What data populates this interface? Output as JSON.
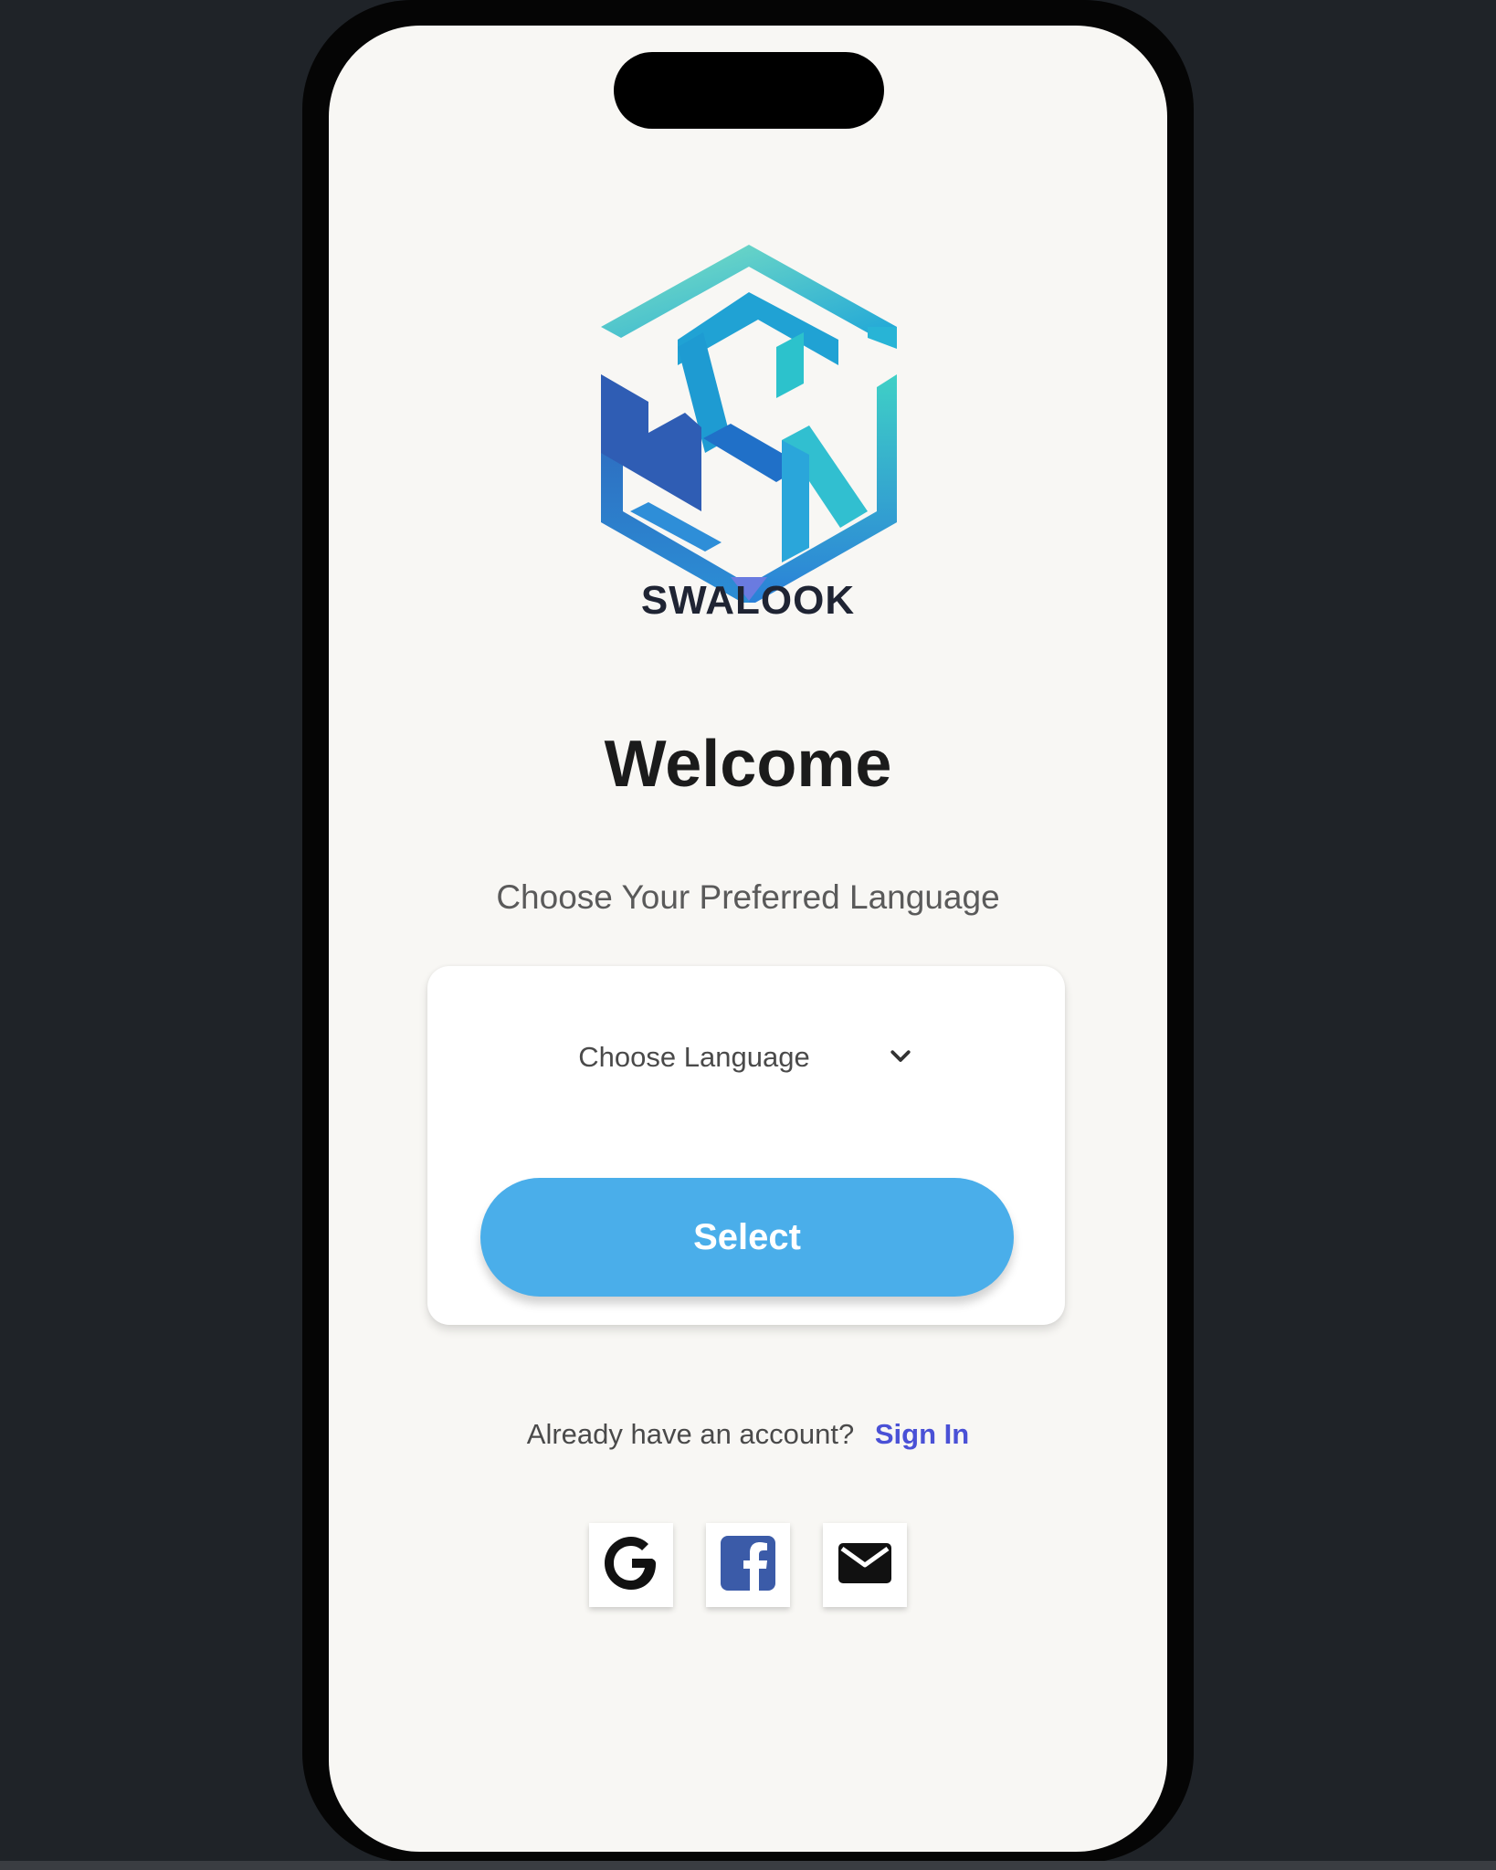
{
  "brand": {
    "name": "SWALOOK"
  },
  "welcome": {
    "title": "Welcome",
    "subtitle": "Choose Your Preferred Language"
  },
  "language_card": {
    "select_placeholder": "Choose Language",
    "button_label": "Select"
  },
  "account": {
    "prompt": "Already have an account?",
    "link": "Sign In"
  },
  "social": {
    "icons": [
      "google-icon",
      "facebook-icon",
      "mail-icon"
    ],
    "google_letter": "G"
  },
  "colors": {
    "accent_button": "#4aaeea",
    "sign_in_link": "#4a51d6",
    "logo_teal": "#36c6c0",
    "logo_blue": "#2a66c2",
    "facebook_blue": "#3b5ba8"
  }
}
